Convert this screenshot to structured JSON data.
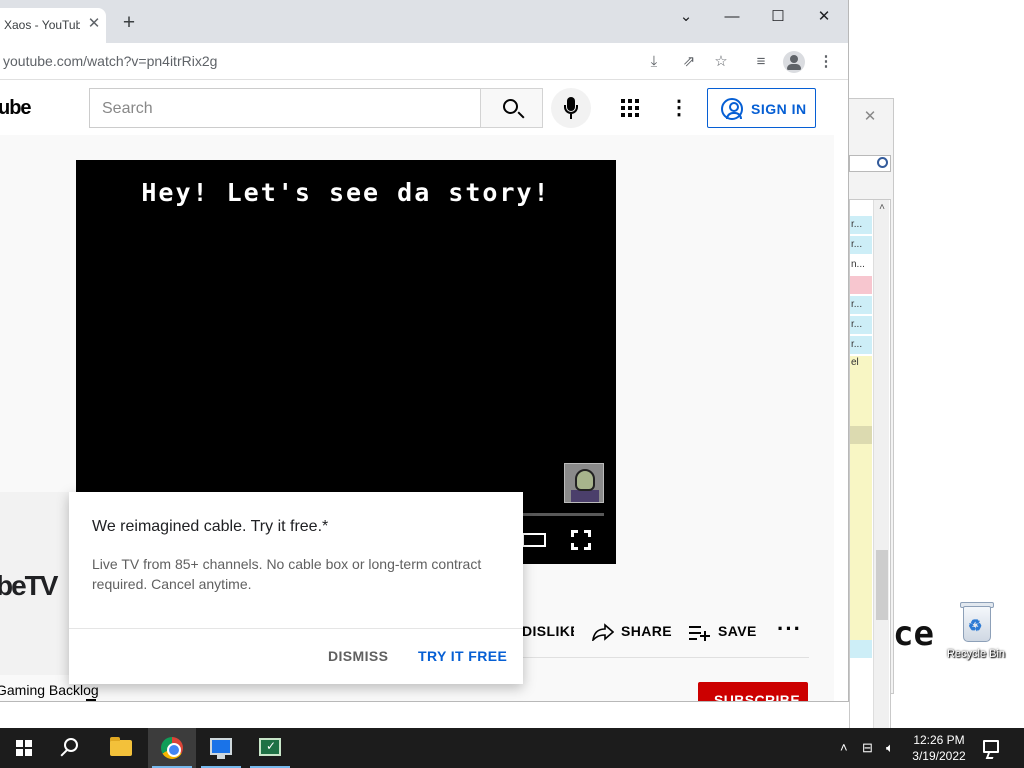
{
  "browser": {
    "tab_title": "Xaos - YouTube",
    "url": "youtube.com/watch?v=pn4itrRix2g"
  },
  "youtube": {
    "logo_fragment": "ube",
    "search_placeholder": "Search",
    "sign_in": "SIGN IN",
    "video_caption": "Hey! Let's see da story!",
    "actions": {
      "dislike": "DISLIKE",
      "share": "SHARE",
      "save": "SAVE"
    },
    "channel_name": "Gaming Backlog",
    "subscribe": "SUBSCRIBE"
  },
  "promo": {
    "logo_fragment": "beTV",
    "title": "We reimagined cable. Try it free.*",
    "body": "Live TV from 85+ channels. No cable box or long-term contract required. Cancel anytime.",
    "dismiss": "DISMISS",
    "try_free": "TRY IT FREE"
  },
  "background_window": {
    "rows": [
      "r...",
      "r...",
      "n...",
      "r...",
      "r...",
      "r...",
      "el"
    ],
    "big_text": "ce"
  },
  "desktop": {
    "recycle_bin": "Recycle Bin"
  },
  "taskbar": {
    "time": "12:26 PM",
    "date": "3/19/2022"
  },
  "colors": {
    "youtube_blue": "#065fd4",
    "subscribe_red": "#cc0000",
    "taskbar": "#1c1c1c"
  }
}
